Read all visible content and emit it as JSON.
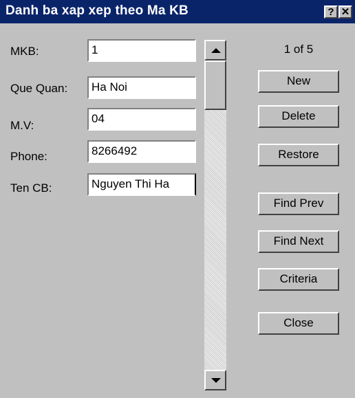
{
  "window": {
    "title": "Danh ba xap xep theo Ma KB",
    "help_label": "?",
    "close_label": "✕"
  },
  "fields": [
    {
      "label": "MKB:",
      "value": "1"
    },
    {
      "label": "Que Quan:",
      "value": "Ha Noi"
    },
    {
      "label": "M.V:",
      "value": "04"
    },
    {
      "label": "Phone:",
      "value": "8266492"
    },
    {
      "label": "Ten CB:",
      "value": "Nguyen Thi Ha"
    }
  ],
  "record_counter": "1 of 5",
  "buttons": {
    "new": "New",
    "delete": "Delete",
    "restore": "Restore",
    "find_prev": "Find Prev",
    "find_next": "Find Next",
    "criteria": "Criteria",
    "close": "Close"
  },
  "icons": {
    "scroll_up": "arrow-up-icon",
    "scroll_down": "arrow-down-icon"
  }
}
